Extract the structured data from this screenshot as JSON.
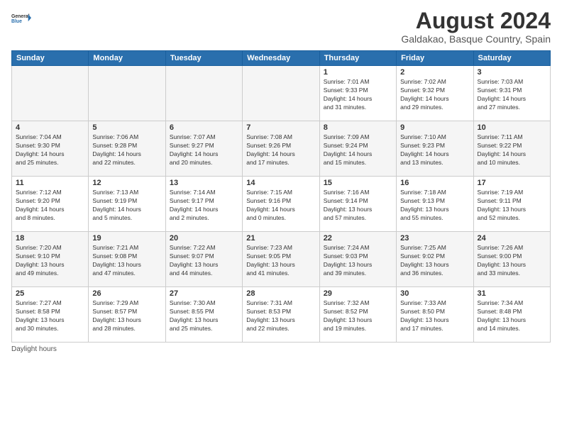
{
  "header": {
    "logo_line1": "General",
    "logo_line2": "Blue",
    "main_title": "August 2024",
    "subtitle": "Galdakao, Basque Country, Spain"
  },
  "weekdays": [
    "Sunday",
    "Monday",
    "Tuesday",
    "Wednesday",
    "Thursday",
    "Friday",
    "Saturday"
  ],
  "weeks": [
    [
      {
        "day": "",
        "info": ""
      },
      {
        "day": "",
        "info": ""
      },
      {
        "day": "",
        "info": ""
      },
      {
        "day": "",
        "info": ""
      },
      {
        "day": "1",
        "info": "Sunrise: 7:01 AM\nSunset: 9:33 PM\nDaylight: 14 hours\nand 31 minutes."
      },
      {
        "day": "2",
        "info": "Sunrise: 7:02 AM\nSunset: 9:32 PM\nDaylight: 14 hours\nand 29 minutes."
      },
      {
        "day": "3",
        "info": "Sunrise: 7:03 AM\nSunset: 9:31 PM\nDaylight: 14 hours\nand 27 minutes."
      }
    ],
    [
      {
        "day": "4",
        "info": "Sunrise: 7:04 AM\nSunset: 9:30 PM\nDaylight: 14 hours\nand 25 minutes."
      },
      {
        "day": "5",
        "info": "Sunrise: 7:06 AM\nSunset: 9:28 PM\nDaylight: 14 hours\nand 22 minutes."
      },
      {
        "day": "6",
        "info": "Sunrise: 7:07 AM\nSunset: 9:27 PM\nDaylight: 14 hours\nand 20 minutes."
      },
      {
        "day": "7",
        "info": "Sunrise: 7:08 AM\nSunset: 9:26 PM\nDaylight: 14 hours\nand 17 minutes."
      },
      {
        "day": "8",
        "info": "Sunrise: 7:09 AM\nSunset: 9:24 PM\nDaylight: 14 hours\nand 15 minutes."
      },
      {
        "day": "9",
        "info": "Sunrise: 7:10 AM\nSunset: 9:23 PM\nDaylight: 14 hours\nand 13 minutes."
      },
      {
        "day": "10",
        "info": "Sunrise: 7:11 AM\nSunset: 9:22 PM\nDaylight: 14 hours\nand 10 minutes."
      }
    ],
    [
      {
        "day": "11",
        "info": "Sunrise: 7:12 AM\nSunset: 9:20 PM\nDaylight: 14 hours\nand 8 minutes."
      },
      {
        "day": "12",
        "info": "Sunrise: 7:13 AM\nSunset: 9:19 PM\nDaylight: 14 hours\nand 5 minutes."
      },
      {
        "day": "13",
        "info": "Sunrise: 7:14 AM\nSunset: 9:17 PM\nDaylight: 14 hours\nand 2 minutes."
      },
      {
        "day": "14",
        "info": "Sunrise: 7:15 AM\nSunset: 9:16 PM\nDaylight: 14 hours\nand 0 minutes."
      },
      {
        "day": "15",
        "info": "Sunrise: 7:16 AM\nSunset: 9:14 PM\nDaylight: 13 hours\nand 57 minutes."
      },
      {
        "day": "16",
        "info": "Sunrise: 7:18 AM\nSunset: 9:13 PM\nDaylight: 13 hours\nand 55 minutes."
      },
      {
        "day": "17",
        "info": "Sunrise: 7:19 AM\nSunset: 9:11 PM\nDaylight: 13 hours\nand 52 minutes."
      }
    ],
    [
      {
        "day": "18",
        "info": "Sunrise: 7:20 AM\nSunset: 9:10 PM\nDaylight: 13 hours\nand 49 minutes."
      },
      {
        "day": "19",
        "info": "Sunrise: 7:21 AM\nSunset: 9:08 PM\nDaylight: 13 hours\nand 47 minutes."
      },
      {
        "day": "20",
        "info": "Sunrise: 7:22 AM\nSunset: 9:07 PM\nDaylight: 13 hours\nand 44 minutes."
      },
      {
        "day": "21",
        "info": "Sunrise: 7:23 AM\nSunset: 9:05 PM\nDaylight: 13 hours\nand 41 minutes."
      },
      {
        "day": "22",
        "info": "Sunrise: 7:24 AM\nSunset: 9:03 PM\nDaylight: 13 hours\nand 39 minutes."
      },
      {
        "day": "23",
        "info": "Sunrise: 7:25 AM\nSunset: 9:02 PM\nDaylight: 13 hours\nand 36 minutes."
      },
      {
        "day": "24",
        "info": "Sunrise: 7:26 AM\nSunset: 9:00 PM\nDaylight: 13 hours\nand 33 minutes."
      }
    ],
    [
      {
        "day": "25",
        "info": "Sunrise: 7:27 AM\nSunset: 8:58 PM\nDaylight: 13 hours\nand 30 minutes."
      },
      {
        "day": "26",
        "info": "Sunrise: 7:29 AM\nSunset: 8:57 PM\nDaylight: 13 hours\nand 28 minutes."
      },
      {
        "day": "27",
        "info": "Sunrise: 7:30 AM\nSunset: 8:55 PM\nDaylight: 13 hours\nand 25 minutes."
      },
      {
        "day": "28",
        "info": "Sunrise: 7:31 AM\nSunset: 8:53 PM\nDaylight: 13 hours\nand 22 minutes."
      },
      {
        "day": "29",
        "info": "Sunrise: 7:32 AM\nSunset: 8:52 PM\nDaylight: 13 hours\nand 19 minutes."
      },
      {
        "day": "30",
        "info": "Sunrise: 7:33 AM\nSunset: 8:50 PM\nDaylight: 13 hours\nand 17 minutes."
      },
      {
        "day": "31",
        "info": "Sunrise: 7:34 AM\nSunset: 8:48 PM\nDaylight: 13 hours\nand 14 minutes."
      }
    ]
  ],
  "footer": {
    "daylight_label": "Daylight hours"
  }
}
